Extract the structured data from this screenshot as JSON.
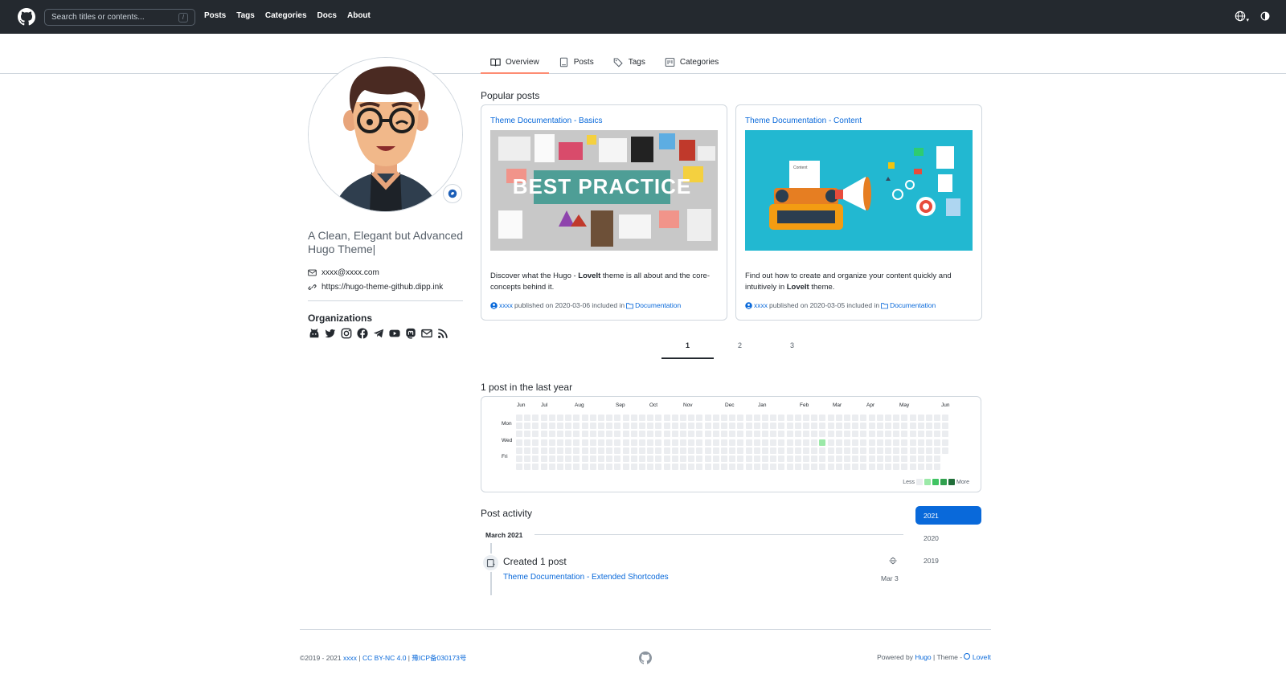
{
  "header": {
    "search_placeholder": "Search titles or contents...",
    "search_key": "/",
    "nav": [
      "Posts",
      "Tags",
      "Categories",
      "Docs",
      "About"
    ]
  },
  "tabs": [
    "Overview",
    "Posts",
    "Tags",
    "Categories"
  ],
  "profile": {
    "bio": "A Clean, Elegant but Advanced Hugo Theme|",
    "email": "xxxx@xxxx.com",
    "website": "https://hugo-theme-github.dipp.ink",
    "organizations_title": "Organizations"
  },
  "popular": {
    "title": "Popular posts",
    "cards": [
      {
        "title": "Theme Documentation - Basics",
        "image_text": "BEST PRACTICE",
        "desc_pre": "Discover what the Hugo - ",
        "desc_bold": "LoveIt",
        "desc_post": " theme is all about and the core-concepts behind it.",
        "author": "xxxx",
        "meta_mid": " published on 2020-03-06 included in ",
        "category": "Documentation"
      },
      {
        "title": "Theme Documentation - Content",
        "image_text": "Content",
        "desc_pre": "Find out how to create and organize your content quickly and intuitively in ",
        "desc_bold": "LoveIt",
        "desc_post": " theme.",
        "author": "xxxx",
        "meta_mid": " published on 2020-03-05 included in ",
        "category": "Documentation"
      }
    ]
  },
  "pagination": [
    "1",
    "2",
    "3"
  ],
  "contributions": {
    "title": "1 post in the last year",
    "months": [
      "Jun",
      "Jul",
      "Aug",
      "Sep",
      "Oct",
      "Nov",
      "Dec",
      "Jan",
      "Feb",
      "Mar",
      "Apr",
      "May",
      "Jun"
    ],
    "days": [
      "Mon",
      "Wed",
      "Fri"
    ],
    "legend_less": "Less",
    "legend_more": "More",
    "colors": [
      "#ebedf0",
      "#9be9a8",
      "#40c463",
      "#30a14e",
      "#216e39"
    ]
  },
  "activity": {
    "title": "Post activity",
    "month": "March 2021",
    "created": "Created 1 post",
    "post": "Theme Documentation - Extended Shortcodes",
    "date": "Mar 3",
    "years": [
      "2021",
      "2020",
      "2019"
    ]
  },
  "footer": {
    "copy": "©2019 - 2021 ",
    "author": "xxxx",
    "license": "CC BY-NC 4.0",
    "icp": "豫ICP备030173号",
    "powered": "Powered by ",
    "hugo": "Hugo",
    "theme_sep": " | Theme - ",
    "theme": "LoveIt"
  }
}
